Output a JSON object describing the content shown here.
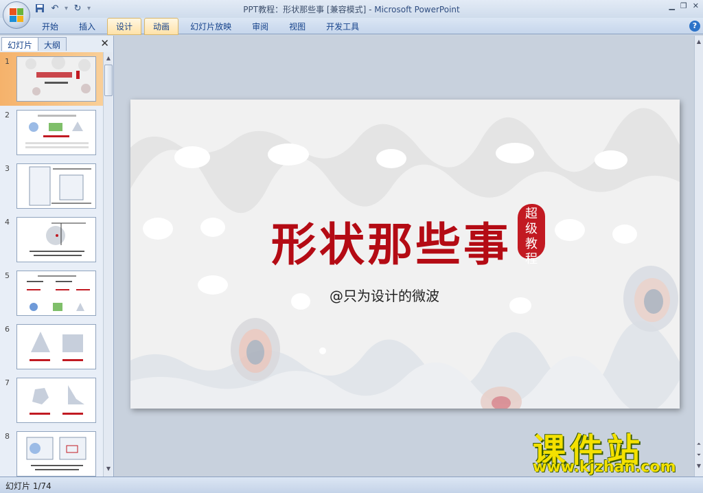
{
  "window": {
    "title_doc": "PPT教程：形状那些事 [兼容模式]",
    "title_sep": " - ",
    "title_app": "Microsoft PowerPoint"
  },
  "ribbon": {
    "tabs": [
      {
        "label": "开始",
        "active": false
      },
      {
        "label": "插入",
        "active": false
      },
      {
        "label": "设计",
        "active": true
      },
      {
        "label": "动画",
        "active": true
      },
      {
        "label": "幻灯片放映",
        "active": false
      },
      {
        "label": "审阅",
        "active": false
      },
      {
        "label": "视图",
        "active": false
      },
      {
        "label": "开发工具",
        "active": false
      }
    ]
  },
  "left_pane": {
    "tabs": [
      "幻灯片",
      "大纲"
    ],
    "thumbnails": [
      "1",
      "2",
      "3",
      "4",
      "5",
      "6",
      "7",
      "8"
    ]
  },
  "slide": {
    "title": "形状那些事",
    "seal": "超级教程",
    "subtitle": "@只为设计的微波",
    "accent_color": "#b40b14"
  },
  "statusbar": {
    "slide_info": "幻灯片 1/74"
  },
  "watermark": {
    "name": "课件站",
    "url": "www.kjzhan.com"
  }
}
